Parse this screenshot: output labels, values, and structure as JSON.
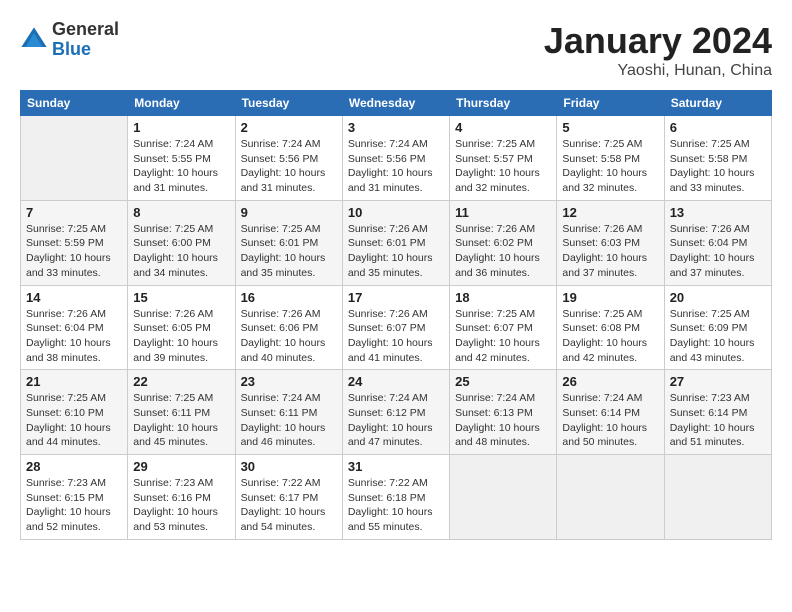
{
  "header": {
    "logo_general": "General",
    "logo_blue": "Blue",
    "month_title": "January 2024",
    "location": "Yaoshi, Hunan, China"
  },
  "weekdays": [
    "Sunday",
    "Monday",
    "Tuesday",
    "Wednesday",
    "Thursday",
    "Friday",
    "Saturday"
  ],
  "weeks": [
    [
      {
        "day": "",
        "sunrise": "",
        "sunset": "",
        "daylight": ""
      },
      {
        "day": "1",
        "sunrise": "Sunrise: 7:24 AM",
        "sunset": "Sunset: 5:55 PM",
        "daylight": "Daylight: 10 hours and 31 minutes."
      },
      {
        "day": "2",
        "sunrise": "Sunrise: 7:24 AM",
        "sunset": "Sunset: 5:56 PM",
        "daylight": "Daylight: 10 hours and 31 minutes."
      },
      {
        "day": "3",
        "sunrise": "Sunrise: 7:24 AM",
        "sunset": "Sunset: 5:56 PM",
        "daylight": "Daylight: 10 hours and 31 minutes."
      },
      {
        "day": "4",
        "sunrise": "Sunrise: 7:25 AM",
        "sunset": "Sunset: 5:57 PM",
        "daylight": "Daylight: 10 hours and 32 minutes."
      },
      {
        "day": "5",
        "sunrise": "Sunrise: 7:25 AM",
        "sunset": "Sunset: 5:58 PM",
        "daylight": "Daylight: 10 hours and 32 minutes."
      },
      {
        "day": "6",
        "sunrise": "Sunrise: 7:25 AM",
        "sunset": "Sunset: 5:58 PM",
        "daylight": "Daylight: 10 hours and 33 minutes."
      }
    ],
    [
      {
        "day": "7",
        "sunrise": "Sunrise: 7:25 AM",
        "sunset": "Sunset: 5:59 PM",
        "daylight": "Daylight: 10 hours and 33 minutes."
      },
      {
        "day": "8",
        "sunrise": "Sunrise: 7:25 AM",
        "sunset": "Sunset: 6:00 PM",
        "daylight": "Daylight: 10 hours and 34 minutes."
      },
      {
        "day": "9",
        "sunrise": "Sunrise: 7:25 AM",
        "sunset": "Sunset: 6:01 PM",
        "daylight": "Daylight: 10 hours and 35 minutes."
      },
      {
        "day": "10",
        "sunrise": "Sunrise: 7:26 AM",
        "sunset": "Sunset: 6:01 PM",
        "daylight": "Daylight: 10 hours and 35 minutes."
      },
      {
        "day": "11",
        "sunrise": "Sunrise: 7:26 AM",
        "sunset": "Sunset: 6:02 PM",
        "daylight": "Daylight: 10 hours and 36 minutes."
      },
      {
        "day": "12",
        "sunrise": "Sunrise: 7:26 AM",
        "sunset": "Sunset: 6:03 PM",
        "daylight": "Daylight: 10 hours and 37 minutes."
      },
      {
        "day": "13",
        "sunrise": "Sunrise: 7:26 AM",
        "sunset": "Sunset: 6:04 PM",
        "daylight": "Daylight: 10 hours and 37 minutes."
      }
    ],
    [
      {
        "day": "14",
        "sunrise": "Sunrise: 7:26 AM",
        "sunset": "Sunset: 6:04 PM",
        "daylight": "Daylight: 10 hours and 38 minutes."
      },
      {
        "day": "15",
        "sunrise": "Sunrise: 7:26 AM",
        "sunset": "Sunset: 6:05 PM",
        "daylight": "Daylight: 10 hours and 39 minutes."
      },
      {
        "day": "16",
        "sunrise": "Sunrise: 7:26 AM",
        "sunset": "Sunset: 6:06 PM",
        "daylight": "Daylight: 10 hours and 40 minutes."
      },
      {
        "day": "17",
        "sunrise": "Sunrise: 7:26 AM",
        "sunset": "Sunset: 6:07 PM",
        "daylight": "Daylight: 10 hours and 41 minutes."
      },
      {
        "day": "18",
        "sunrise": "Sunrise: 7:25 AM",
        "sunset": "Sunset: 6:07 PM",
        "daylight": "Daylight: 10 hours and 42 minutes."
      },
      {
        "day": "19",
        "sunrise": "Sunrise: 7:25 AM",
        "sunset": "Sunset: 6:08 PM",
        "daylight": "Daylight: 10 hours and 42 minutes."
      },
      {
        "day": "20",
        "sunrise": "Sunrise: 7:25 AM",
        "sunset": "Sunset: 6:09 PM",
        "daylight": "Daylight: 10 hours and 43 minutes."
      }
    ],
    [
      {
        "day": "21",
        "sunrise": "Sunrise: 7:25 AM",
        "sunset": "Sunset: 6:10 PM",
        "daylight": "Daylight: 10 hours and 44 minutes."
      },
      {
        "day": "22",
        "sunrise": "Sunrise: 7:25 AM",
        "sunset": "Sunset: 6:11 PM",
        "daylight": "Daylight: 10 hours and 45 minutes."
      },
      {
        "day": "23",
        "sunrise": "Sunrise: 7:24 AM",
        "sunset": "Sunset: 6:11 PM",
        "daylight": "Daylight: 10 hours and 46 minutes."
      },
      {
        "day": "24",
        "sunrise": "Sunrise: 7:24 AM",
        "sunset": "Sunset: 6:12 PM",
        "daylight": "Daylight: 10 hours and 47 minutes."
      },
      {
        "day": "25",
        "sunrise": "Sunrise: 7:24 AM",
        "sunset": "Sunset: 6:13 PM",
        "daylight": "Daylight: 10 hours and 48 minutes."
      },
      {
        "day": "26",
        "sunrise": "Sunrise: 7:24 AM",
        "sunset": "Sunset: 6:14 PM",
        "daylight": "Daylight: 10 hours and 50 minutes."
      },
      {
        "day": "27",
        "sunrise": "Sunrise: 7:23 AM",
        "sunset": "Sunset: 6:14 PM",
        "daylight": "Daylight: 10 hours and 51 minutes."
      }
    ],
    [
      {
        "day": "28",
        "sunrise": "Sunrise: 7:23 AM",
        "sunset": "Sunset: 6:15 PM",
        "daylight": "Daylight: 10 hours and 52 minutes."
      },
      {
        "day": "29",
        "sunrise": "Sunrise: 7:23 AM",
        "sunset": "Sunset: 6:16 PM",
        "daylight": "Daylight: 10 hours and 53 minutes."
      },
      {
        "day": "30",
        "sunrise": "Sunrise: 7:22 AM",
        "sunset": "Sunset: 6:17 PM",
        "daylight": "Daylight: 10 hours and 54 minutes."
      },
      {
        "day": "31",
        "sunrise": "Sunrise: 7:22 AM",
        "sunset": "Sunset: 6:18 PM",
        "daylight": "Daylight: 10 hours and 55 minutes."
      },
      {
        "day": "",
        "sunrise": "",
        "sunset": "",
        "daylight": ""
      },
      {
        "day": "",
        "sunrise": "",
        "sunset": "",
        "daylight": ""
      },
      {
        "day": "",
        "sunrise": "",
        "sunset": "",
        "daylight": ""
      }
    ]
  ]
}
